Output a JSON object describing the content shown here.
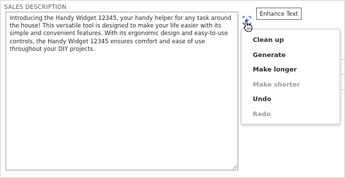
{
  "field": {
    "label": "SALES DESCRIPTION",
    "lines": [
      "Introducing the Handy Widget 12345, your handy helper for any task around",
      "the house! This versatile tool is designed to make your life easier with its",
      "simple and convenient features. With its ergonomic design and easy-to-use",
      "controls, the Handy Widget 12345 ensures comfort and ease of use",
      "throughout your DIY projects."
    ]
  },
  "enhance": {
    "icon": "sparkle-icon",
    "tooltip": "Enhance Text"
  },
  "menu": {
    "items": [
      {
        "label": "Clean up",
        "enabled": true
      },
      {
        "label": "Generate",
        "enabled": true
      },
      {
        "label": "Make longer",
        "enabled": true
      },
      {
        "label": "Make shorter",
        "enabled": false
      },
      {
        "label": "Undo",
        "enabled": true
      },
      {
        "label": "Redo",
        "enabled": false
      }
    ]
  },
  "colors": {
    "accent": "#2a78c2",
    "disabled_text": "#9e9e9e"
  }
}
